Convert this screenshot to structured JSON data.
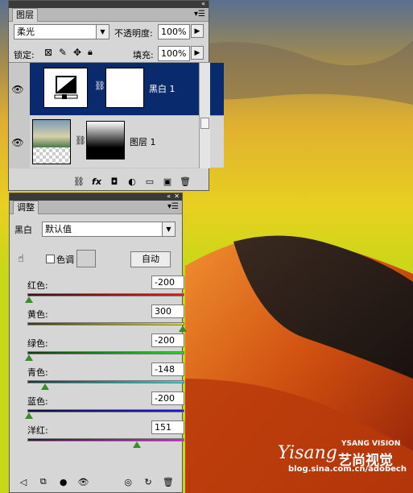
{
  "layers_panel": {
    "tab": "图层",
    "blend_mode": "柔光",
    "opacity_label": "不透明度:",
    "opacity_value": "100%",
    "lock_label": "锁定:",
    "fill_label": "填充:",
    "fill_value": "100%",
    "layers": [
      {
        "name": "黑白 1",
        "selected": true
      },
      {
        "name": "图层 1",
        "selected": false
      }
    ]
  },
  "adjust_panel": {
    "tab": "调整",
    "type_label": "黑白",
    "preset_value": "默认值",
    "tint_label": "色调",
    "auto_button": "自动",
    "sliders": [
      {
        "label": "红色:",
        "value": "-200",
        "level": 0.0,
        "gradient": "linear-gradient(to right,#3a1010,#e01818)"
      },
      {
        "label": "黄色:",
        "value": "300",
        "level": 1.0,
        "gradient": "linear-gradient(to right,#3a3a10,#e0e018)"
      },
      {
        "label": "绿色:",
        "value": "-200",
        "level": 0.0,
        "gradient": "linear-gradient(to right,#103a10,#18e018)"
      },
      {
        "label": "青色:",
        "value": "-148",
        "level": 0.104,
        "gradient": "linear-gradient(to right,#103a3a,#18e0e0)"
      },
      {
        "label": "蓝色:",
        "value": "-200",
        "level": 0.0,
        "gradient": "linear-gradient(to right,#10103a,#1818e0)"
      },
      {
        "label": "洋红:",
        "value": "151",
        "level": 0.702,
        "gradient": "linear-gradient(to right,#3a103a,#e018e0)"
      }
    ]
  },
  "watermark": {
    "logo": "Yisang",
    "title_en": "YSANG VISION",
    "title_cn": "艺尚视觉",
    "url": "blog.sina.com.cn/adobech"
  },
  "colors": {
    "panel_bg": "#d6d6d6",
    "selected_layer": "#0a2a6e",
    "titlebar": "#3a3a3a"
  }
}
